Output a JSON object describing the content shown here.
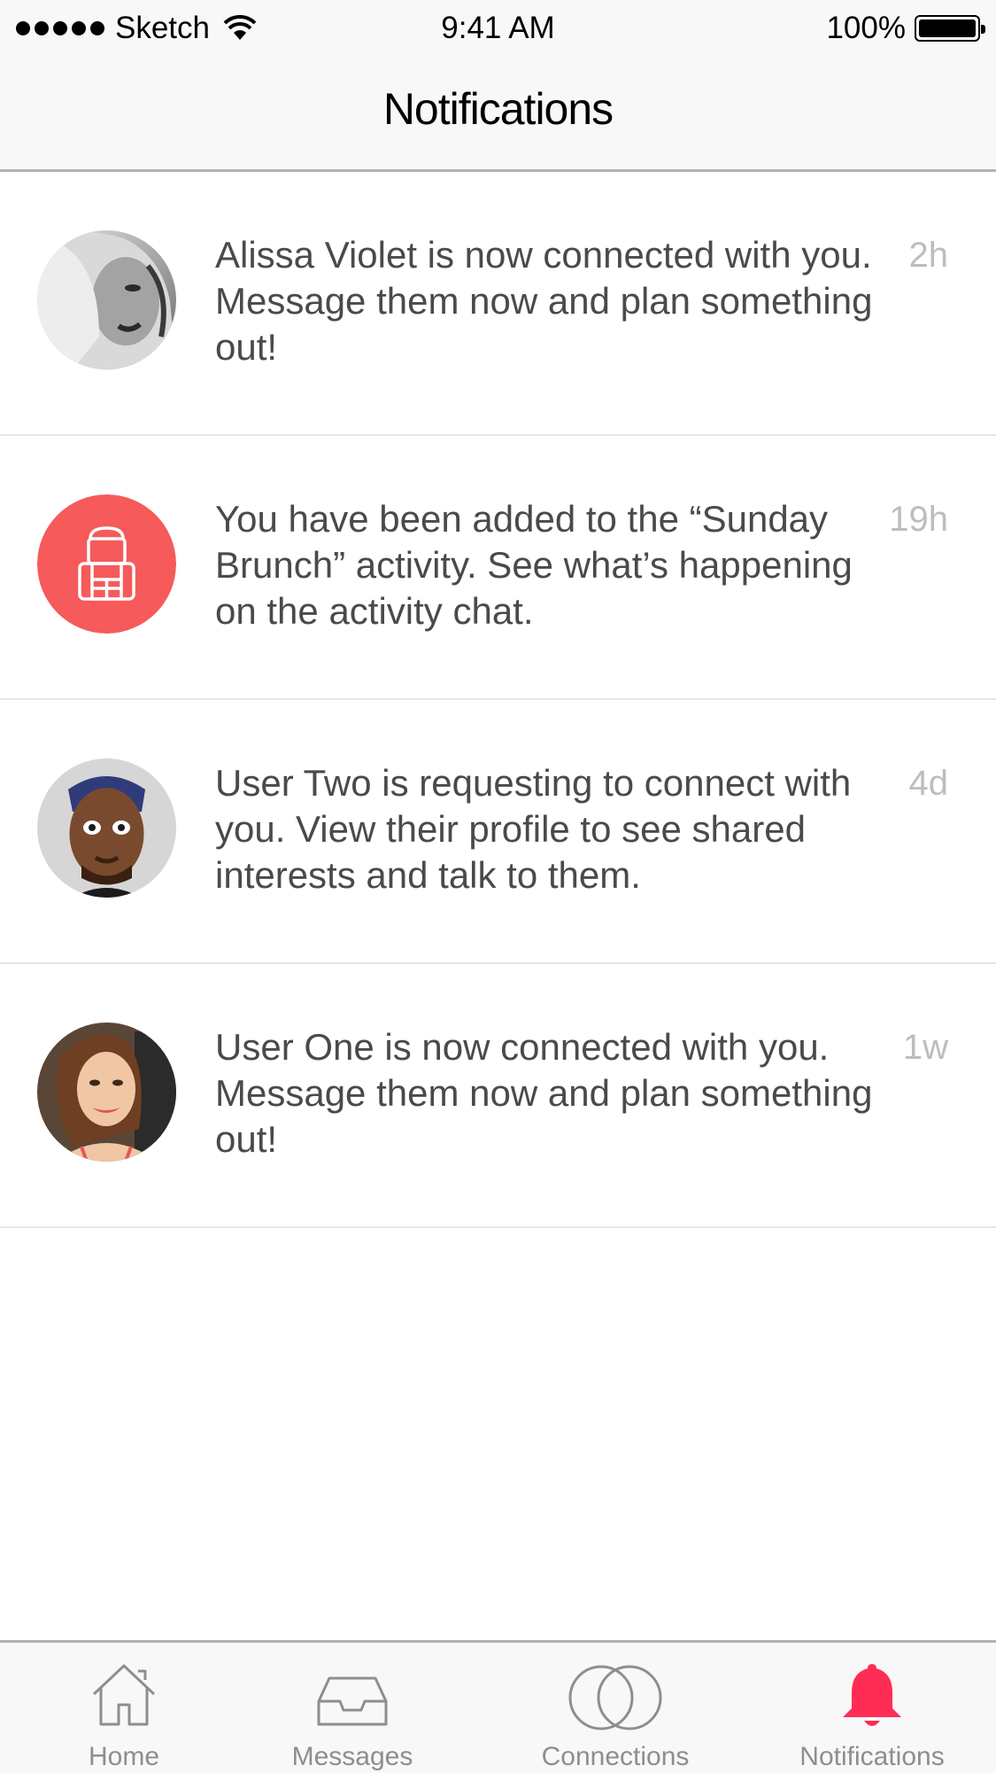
{
  "status_bar": {
    "carrier": "Sketch",
    "time": "9:41 AM",
    "battery": "100%"
  },
  "nav": {
    "title": "Notifications"
  },
  "notifications": [
    {
      "text": "Alissa Violet is now connected with you. Message them now and plan something out!",
      "time": "2h",
      "avatar": "user-photo-alissa-violet"
    },
    {
      "text": "You have been added to the “Sunday Brunch” activity. See what’s happening on the activity chat.",
      "time": "19h",
      "avatar": "backpack-icon",
      "avatar_color": "#f65a5b"
    },
    {
      "text": "User Two is requesting to connect with you. View their profile to see shared interests and talk to them.",
      "time": "4d",
      "avatar": "user-photo-user-two"
    },
    {
      "text": "User One is now connected with you. Message them now and plan something out!",
      "time": "1w",
      "avatar": "user-photo-user-one"
    }
  ],
  "tabs": [
    {
      "label": "Home",
      "icon": "home-icon",
      "active": false
    },
    {
      "label": "Messages",
      "icon": "inbox-icon",
      "active": false
    },
    {
      "label": "Connections",
      "icon": "overlapping-circles-icon",
      "active": false
    },
    {
      "label": "Notifications",
      "icon": "bell-icon",
      "active": true
    }
  ],
  "colors": {
    "accent": "#ff2d55",
    "activity": "#f65a5b",
    "bar_background": "#f8f8f8",
    "text": "#4a4a4a",
    "timestamp": "#bdbdbd"
  }
}
